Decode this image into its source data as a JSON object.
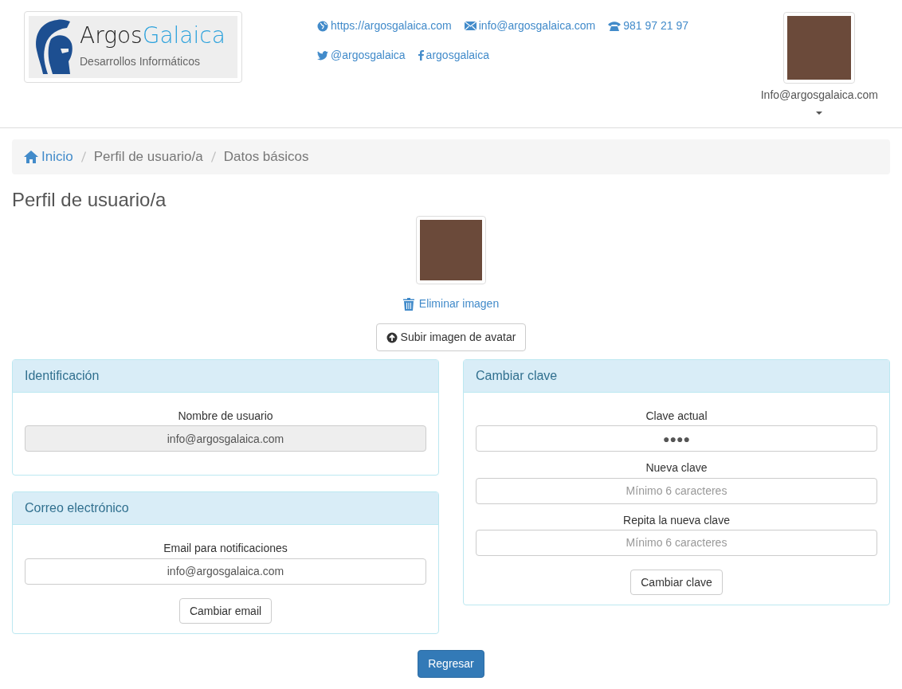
{
  "header": {
    "logo": {
      "name_dark": "Argos",
      "name_accent": "Galaica",
      "tagline": "Desarrollos Informáticos"
    },
    "contact_rows": [
      [
        {
          "kind": "web",
          "text": "https://argosgalaica.com"
        },
        {
          "kind": "mail",
          "text": "info@argosgalaica.com"
        },
        {
          "kind": "phone",
          "text": "981 97 21 97"
        }
      ],
      [
        {
          "kind": "twitter",
          "text": "@argosgalaica"
        },
        {
          "kind": "facebook",
          "text": "argosgalaica"
        }
      ]
    ],
    "user": {
      "name": "Info@argosgalaica.com"
    }
  },
  "breadcrumb": [
    {
      "text": "Inicio",
      "kind": "home"
    },
    {
      "text": "Perfil de usuario/a",
      "kind": "plain"
    },
    {
      "text": "Datos básicos",
      "kind": "plain"
    }
  ],
  "title": "Perfil de usuario/a",
  "avatar": {
    "delete_link": "Eliminar imagen",
    "upload_button": "Subir imagen de avatar"
  },
  "panel_columns": [
    [
      {
        "title": "Identificación",
        "fields": [
          {
            "label": "Nombre de usuario",
            "value": "info@argosgalaica.com",
            "disabled": true
          }
        ]
      },
      {
        "title": "Correo electrónico",
        "fields": [
          {
            "label": "Email para notificaciones",
            "value": "info@argosgalaica.com",
            "disabled": false
          }
        ],
        "button": "Cambiar email"
      }
    ],
    [
      {
        "title": "Cambiar clave",
        "fields": [
          {
            "label": "Clave actual",
            "value": "●●●●",
            "disabled": false
          },
          {
            "label": "Nueva clave",
            "placeholder": "Mínimo 6 caracteres",
            "disabled": false
          },
          {
            "label": "Repita la nueva clave",
            "placeholder": "Mínimo 6 caracteres",
            "disabled": false
          }
        ],
        "button": "Cambiar clave"
      }
    ]
  ],
  "back_button": "Regresar"
}
